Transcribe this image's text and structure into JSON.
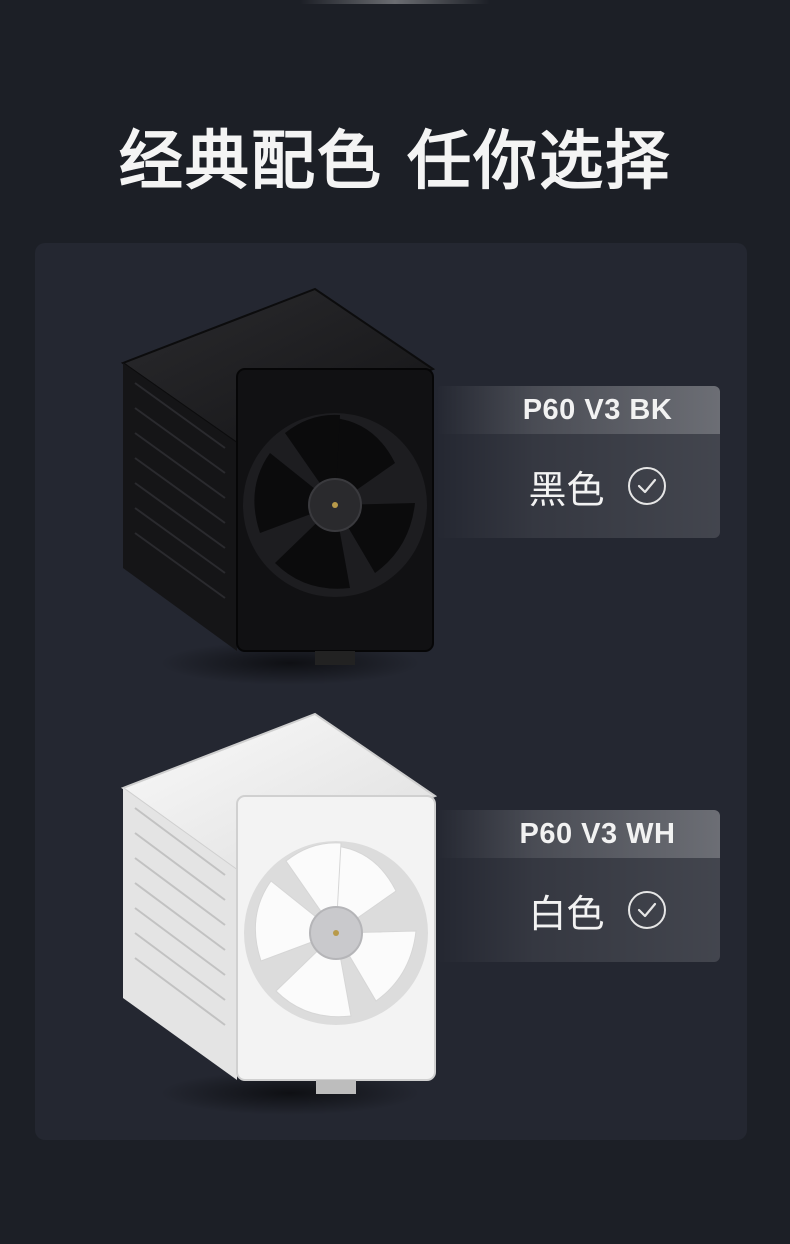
{
  "headline": "经典配色 任你选择",
  "variants": [
    {
      "model": "P60 V3 BK",
      "color_name": "黑色",
      "check_icon": "check-circle-icon",
      "product_color": "#1a1a1c"
    },
    {
      "model": "P60 V3 WH",
      "color_name": "白色",
      "check_icon": "check-circle-icon",
      "product_color": "#f2f2f2"
    }
  ],
  "colors": {
    "background": "#1c1f26",
    "panel": "#242731"
  }
}
